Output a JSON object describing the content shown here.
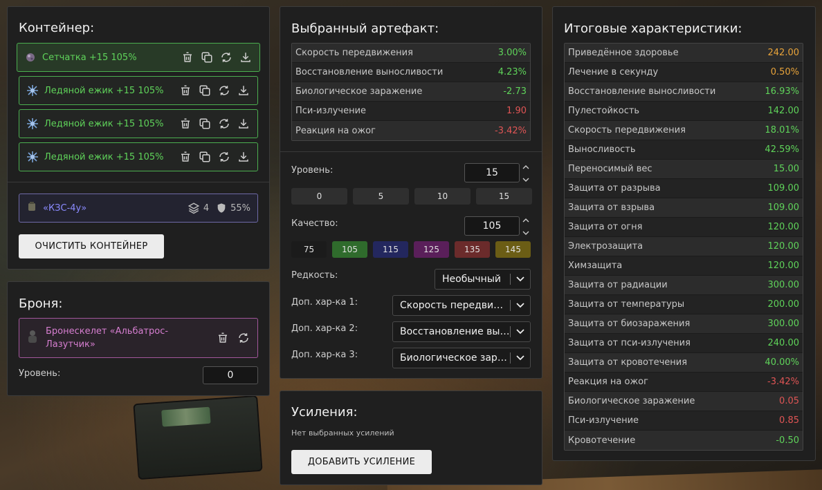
{
  "container": {
    "title": "Контейнер:",
    "artifacts": [
      {
        "label": "Сетчатка +15 105%",
        "icon": "retina-artifact-icon",
        "active": true
      },
      {
        "label": "Ледяной ежик +15 105%",
        "icon": "ice-hedgehog-artifact-icon",
        "active": false
      },
      {
        "label": "Ледяной ежик +15 105%",
        "icon": "ice-hedgehog-artifact-icon",
        "active": false
      },
      {
        "label": "Ледяной ежик +15 105%",
        "icon": "ice-hedgehog-artifact-icon",
        "active": false
      }
    ],
    "container_item": {
      "label": "«КЗС-4у»",
      "slots": "4",
      "protection": "55%"
    },
    "clear_label": "ОЧИСТИТЬ КОНТЕЙНЕР"
  },
  "armor": {
    "title": "Броня:",
    "item_label": "Бронескелет «Альбатрос-Лазутчик»",
    "level_label": "Уровень:",
    "level_value": "0"
  },
  "artifact": {
    "title": "Выбранный артефакт:",
    "stats": [
      {
        "name": "Скорость передвижения",
        "value": "3.00%",
        "color": "green"
      },
      {
        "name": "Восстановление выносливости",
        "value": "4.23%",
        "color": "green"
      },
      {
        "name": "Биологическое заражение",
        "value": "-2.73",
        "color": "green"
      },
      {
        "name": "Пси-излучение",
        "value": "1.90",
        "color": "red"
      },
      {
        "name": "Реакция на ожог",
        "value": "-3.42%",
        "color": "red"
      }
    ],
    "level_label": "Уровень:",
    "level_value": "15",
    "level_presets": [
      "0",
      "5",
      "10",
      "15"
    ],
    "quality_label": "Качество:",
    "quality_value": "105",
    "quality_presets": [
      {
        "label": "75",
        "color": "#1b1b1b"
      },
      {
        "label": "105",
        "color": "#2f6b2c"
      },
      {
        "label": "115",
        "color": "#23275e"
      },
      {
        "label": "125",
        "color": "#5a1f5a"
      },
      {
        "label": "135",
        "color": "#6b2b2b"
      },
      {
        "label": "145",
        "color": "#6b5d15"
      }
    ],
    "rarity_label": "Редкость:",
    "rarity_value": "Необычный",
    "extra1_label": "Доп. хар-ка 1:",
    "extra1_value": "Скорость передвижения",
    "extra2_label": "Доп. хар-ка 2:",
    "extra2_value": "Восстановление выносливости",
    "extra3_label": "Доп. хар-ка 3:",
    "extra3_value": "Биологическое заражение"
  },
  "boosts": {
    "title": "Усиления:",
    "empty_text": "Нет выбранных усилений",
    "add_label": "ДОБАВИТЬ УСИЛЕНИЕ"
  },
  "totals": {
    "title": "Итоговые характеристики:",
    "stats": [
      {
        "name": "Приведённое здоровье",
        "value": "242.00",
        "color": "orange"
      },
      {
        "name": "Лечение в секунду",
        "value": "0.50%",
        "color": "orange"
      },
      {
        "name": "Восстановление выносливости",
        "value": "16.93%",
        "color": "green"
      },
      {
        "name": "Пулестойкость",
        "value": "142.00",
        "color": "green"
      },
      {
        "name": "Скорость передвижения",
        "value": "18.01%",
        "color": "green"
      },
      {
        "name": "Выносливость",
        "value": "42.59%",
        "color": "green"
      },
      {
        "name": "Переносимый вес",
        "value": "15.00",
        "color": "green"
      },
      {
        "name": "Защита от разрыва",
        "value": "109.00",
        "color": "green"
      },
      {
        "name": "Защита от взрыва",
        "value": "109.00",
        "color": "green"
      },
      {
        "name": "Защита от огня",
        "value": "120.00",
        "color": "green"
      },
      {
        "name": "Электрозащита",
        "value": "120.00",
        "color": "green"
      },
      {
        "name": "Химзащита",
        "value": "120.00",
        "color": "green"
      },
      {
        "name": "Защита от радиации",
        "value": "300.00",
        "color": "green"
      },
      {
        "name": "Защита от температуры",
        "value": "200.00",
        "color": "green"
      },
      {
        "name": "Защита от биозаражения",
        "value": "300.00",
        "color": "green"
      },
      {
        "name": "Защита от пси-излучения",
        "value": "240.00",
        "color": "green"
      },
      {
        "name": "Защита от кровотечения",
        "value": "40.00%",
        "color": "green"
      },
      {
        "name": "Реакция на ожог",
        "value": "-3.42%",
        "color": "red"
      },
      {
        "name": "Биологическое заражение",
        "value": "0.05",
        "color": "red"
      },
      {
        "name": "Пси-излучение",
        "value": "0.85",
        "color": "red"
      },
      {
        "name": "Кровотечение",
        "value": "-0.50",
        "color": "green"
      }
    ]
  }
}
